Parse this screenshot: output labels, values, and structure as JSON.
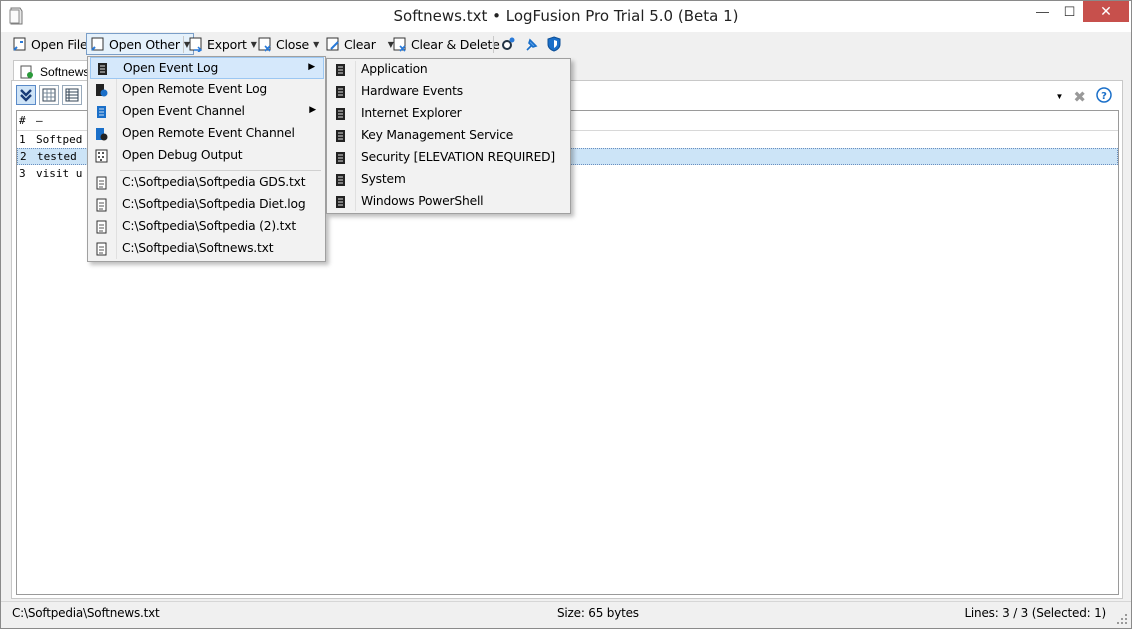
{
  "window": {
    "title": "Softnews.txt • LogFusion Pro Trial 5.0 (Beta 1)",
    "min_glyph": "—",
    "max_glyph": "☐",
    "close_glyph": "✕"
  },
  "toolbar": {
    "open_file": "Open File",
    "open_other": "Open Other",
    "export": "Export",
    "close": "Close",
    "clear": "Clear",
    "clear_delete": "Clear & Delete"
  },
  "tab": {
    "label": "Softnews"
  },
  "log": {
    "header_num": "#",
    "header_col": "–",
    "rows": [
      {
        "num": "1",
        "text": "Softped"
      },
      {
        "num": "2",
        "text": "tested"
      },
      {
        "num": "3",
        "text": "visit u"
      }
    ]
  },
  "menu_main": {
    "items": [
      {
        "label": "Open Event Log",
        "icon": "event-log-icon",
        "has_sub": true
      },
      {
        "label": "Open Remote Event Log",
        "icon": "remote-event-log-icon",
        "has_sub": false
      },
      {
        "label": "Open Event Channel",
        "icon": "event-channel-icon",
        "has_sub": true
      },
      {
        "label": "Open Remote Event Channel",
        "icon": "remote-event-channel-icon",
        "has_sub": false
      },
      {
        "label": "Open Debug Output",
        "icon": "debug-output-icon",
        "has_sub": false
      }
    ],
    "recent": [
      "C:\\Softpedia\\Softpedia GDS.txt",
      "C:\\Softpedia\\Softpedia Diet.log",
      "C:\\Softpedia\\Softpedia (2).txt",
      "C:\\Softpedia\\Softnews.txt"
    ]
  },
  "menu_sub": {
    "items": [
      "Application",
      "Hardware Events",
      "Internet Explorer",
      "Key Management Service",
      "Security [ELEVATION REQUIRED]",
      "System",
      "Windows PowerShell"
    ]
  },
  "status": {
    "path": "C:\\Softpedia\\Softnews.txt",
    "size": "Size: 65 bytes",
    "lines": "Lines: 3 / 3 (Selected: 1)"
  },
  "colors": {
    "highlight": "#d5e8fb",
    "accent": "#1a6fc9",
    "close_red": "#c7504c"
  }
}
